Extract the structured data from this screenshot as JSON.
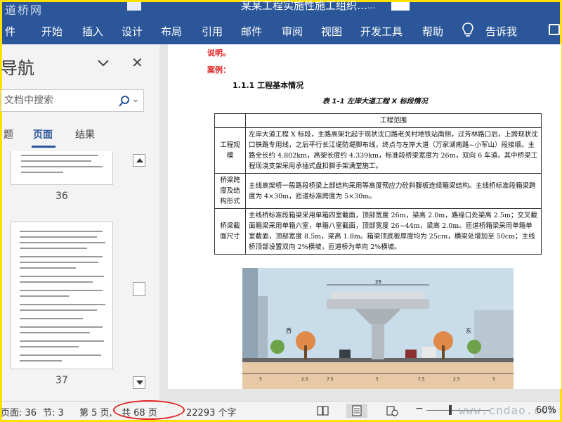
{
  "watermark": "道桥网",
  "window": {
    "title": "某某工程实施性施工组织…",
    "side_mark": "…"
  },
  "ribbon": {
    "tabs": [
      "件",
      "开始",
      "插入",
      "设计",
      "布局",
      "引用",
      "邮件",
      "审阅",
      "视图",
      "开发工具",
      "帮助"
    ],
    "tell_me": "告诉我"
  },
  "nav": {
    "title": "导航",
    "search_placeholder": "文档中搜索",
    "tabs": [
      "题",
      "页面",
      "结果"
    ],
    "active_tab": "页面",
    "pages": [
      "36",
      "37"
    ]
  },
  "document": {
    "label_note": "说明。",
    "label_example": "案例：",
    "heading": "1.1.1 工程基本情况",
    "caption": "表 1-1    左岸大道工程 X 标段情况",
    "table": {
      "header": "工程范围",
      "rows": [
        {
          "label": "工程规模",
          "text": "左岸大道工程 X 标段，主路高架北起于现状沈口路老关村地铁站南侧，过芳林路口后，上跨现状沈口铁路专用线，之后平行长江堤防堤脚布线，终点与左岸大道（万家湖南路~小军山）段接顺。主路全长约 4.802km，高架长度约 4.339km，标准段桥梁宽度为 26m，双向 6 车道。其中桥梁工程现浇支架采用承插式盘扣脚手架满堂施工。"
        },
        {
          "label": "桥梁跨度及结构形式",
          "text": "主线高架桥一般路段桥梁上部结构采用等高度预应力砼斜腹板连续箱梁结构。主线桥标准段箱梁跨度为 4×30m，匝道标准跨度为 5×30m。"
        },
        {
          "label": "桥梁截面尺寸",
          "text": "主线桥标准段箱梁采用单箱四室截面，顶部宽度 26m，梁高 2.0m，路缘口处梁高 2.5m；交叉截面箱梁采用单箱六室，单箱八室截面，顶部宽度 26~44m，梁高 2.0m。匝道桥箱梁采用单箱单室截面，顶部宽度 8.5m，梁高 1.8m。箱梁顶底板厚度均为 25cm，横梁处增加至 50cm；主线桥顶部设置双向 2%横坡，匝道桥为单向 2%横坡。"
        }
      ]
    },
    "figure": {
      "top_dim": "26",
      "side_labels": [
        "西",
        "东"
      ],
      "bottom_dims": [
        "5",
        "2.5",
        "7.5",
        "5",
        "7.5",
        "2.5",
        "5"
      ]
    }
  },
  "status": {
    "page_index": "页面: 36",
    "section": "节: 3",
    "page_of": "第 5 页,",
    "total_pages": "共 68 页",
    "word_count": "22293 个字",
    "zoom": "60%",
    "watermark": "www.cndao.com"
  },
  "colors": {
    "accent": "#2b579a",
    "highlight": "#e02020",
    "frame": "#ffe000"
  },
  "icons": [
    "chevron-down-icon",
    "close-icon",
    "search-icon",
    "lightbulb-icon",
    "comment-icon",
    "read-mode-icon",
    "print-layout-icon",
    "web-layout-icon"
  ]
}
